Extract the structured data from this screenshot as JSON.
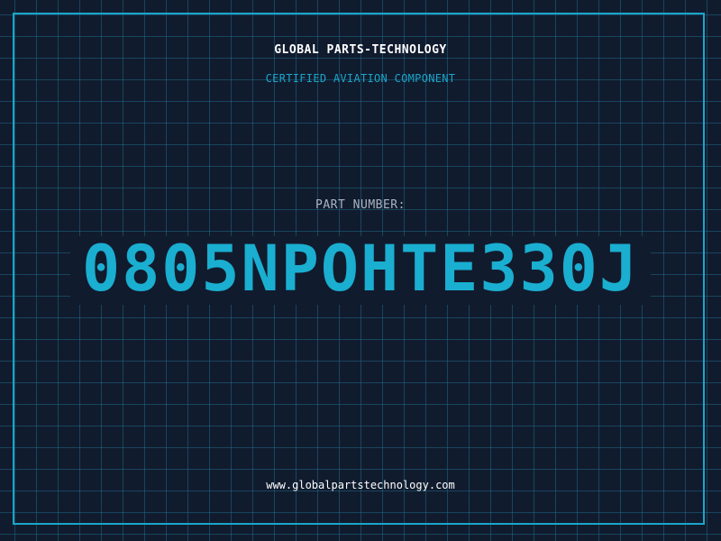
{
  "header": {
    "company": "GLOBAL PARTS-TECHNOLOGY",
    "tagline": "CERTIFIED AVIATION COMPONENT"
  },
  "part": {
    "label": "PART NUMBER:",
    "number": "0805NPOHTE330J"
  },
  "footer": {
    "website": "www.globalpartstechnology.com"
  },
  "colors": {
    "background": "#111b2e",
    "accent": "#1aa5c8",
    "grid": "#207896",
    "text_primary": "#ffffff",
    "text_muted": "#a9b4c2"
  }
}
